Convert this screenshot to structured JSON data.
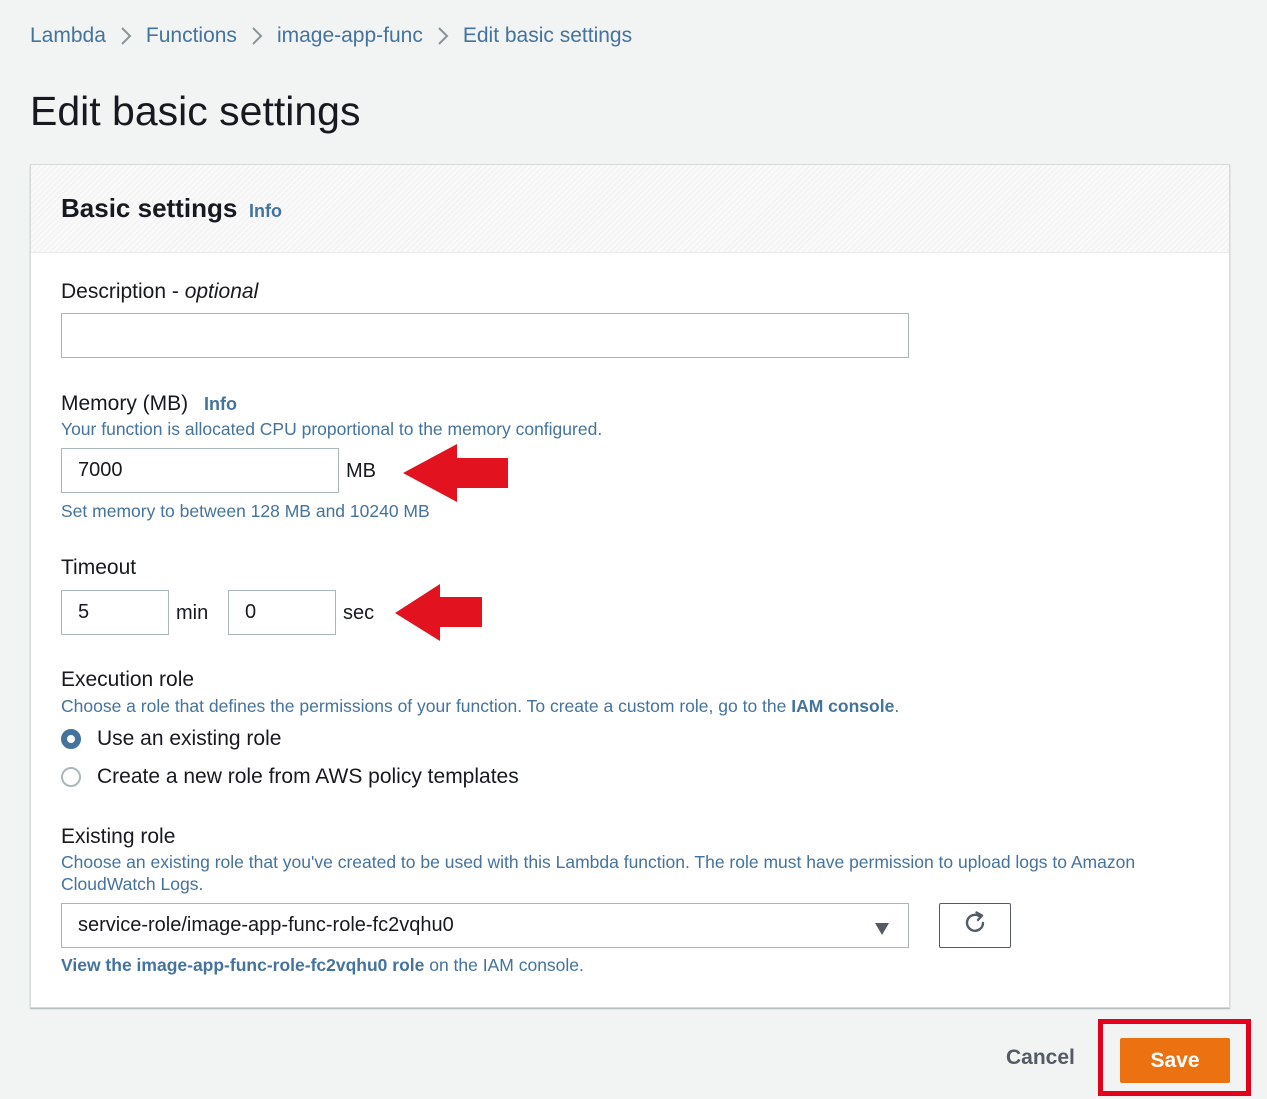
{
  "breadcrumb": {
    "items": [
      "Lambda",
      "Functions",
      "image-app-func"
    ],
    "current": "Edit basic settings"
  },
  "page": {
    "title": "Edit basic settings"
  },
  "panel": {
    "title": "Basic settings",
    "info": "Info"
  },
  "description": {
    "label": "Description - ",
    "label_optional": "optional",
    "value": ""
  },
  "memory": {
    "label": "Memory (MB)",
    "info": "Info",
    "help": "Your function is allocated CPU proportional to the memory configured.",
    "value": "7000",
    "unit": "MB",
    "constraint": "Set memory to between 128 MB and 10240 MB"
  },
  "timeout": {
    "label": "Timeout",
    "min_value": "5",
    "min_unit": "min",
    "sec_value": "0",
    "sec_unit": "sec"
  },
  "execution_role": {
    "label": "Execution role",
    "help_prefix": "Choose a role that defines the permissions of your function. To create a custom role, go to the ",
    "help_link": "IAM console",
    "help_suffix": ".",
    "options": [
      "Use an existing role",
      "Create a new role from AWS policy templates"
    ],
    "selected_index": 0
  },
  "existing_role": {
    "label": "Existing role",
    "help": "Choose an existing role that you've created to be used with this Lambda function. The role must have permission to upload logs to Amazon CloudWatch Logs.",
    "selected": "service-role/image-app-func-role-fc2vqhu0",
    "view_link": "View the image-app-func-role-fc2vqhu0 role",
    "view_suffix": " on the IAM console."
  },
  "footer": {
    "cancel": "Cancel",
    "save": "Save"
  },
  "icons": {
    "breadcrumb_separator": "chevron-right-icon",
    "select_caret": "caret-down-icon",
    "refresh": "refresh-icon",
    "annotation_arrow": "red-arrow-icon"
  },
  "colors": {
    "link": "#44739e",
    "primary_button": "#ec7211",
    "annotation": "#e3001b",
    "background": "#f2f3f3"
  }
}
